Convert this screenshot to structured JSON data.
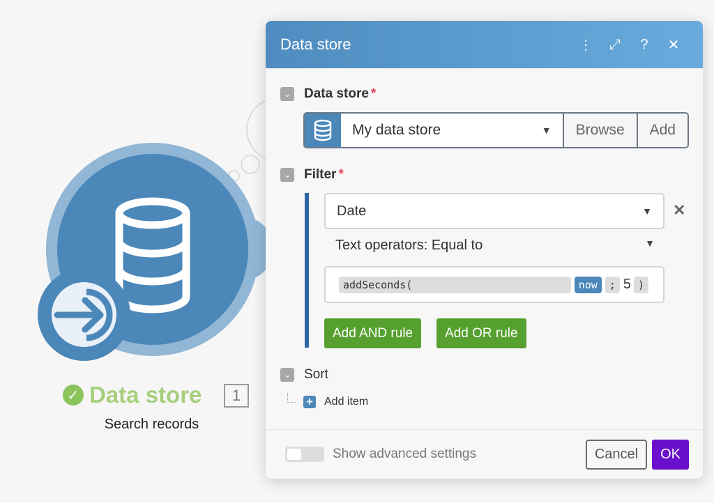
{
  "module": {
    "title": "Data store",
    "subtitle": "Search records",
    "count": "1",
    "status": "success"
  },
  "dialog": {
    "title": "Data store",
    "header_icons": [
      "more-icon",
      "expand-icon",
      "help-icon",
      "close-icon"
    ],
    "data_store": {
      "label": "Data store",
      "required": "*",
      "value": "My data store",
      "browse": "Browse",
      "add": "Add"
    },
    "filter": {
      "label": "Filter",
      "required": "*",
      "field": "Date",
      "operator": "Text operators: Equal to",
      "tokens": {
        "fn": "addSeconds(",
        "var": "now",
        "sep": ";",
        "num": "5",
        "close": ")"
      },
      "add_and": "Add AND rule",
      "add_or": "Add OR rule"
    },
    "sort": {
      "label": "Sort",
      "add_item": "Add item"
    },
    "footer": {
      "advanced": "Show advanced settings",
      "advanced_on": false,
      "cancel": "Cancel",
      "ok": "OK"
    }
  },
  "colors": {
    "accent": "#4b87b9",
    "green": "#56a030",
    "ok": "#6a0fcb"
  }
}
